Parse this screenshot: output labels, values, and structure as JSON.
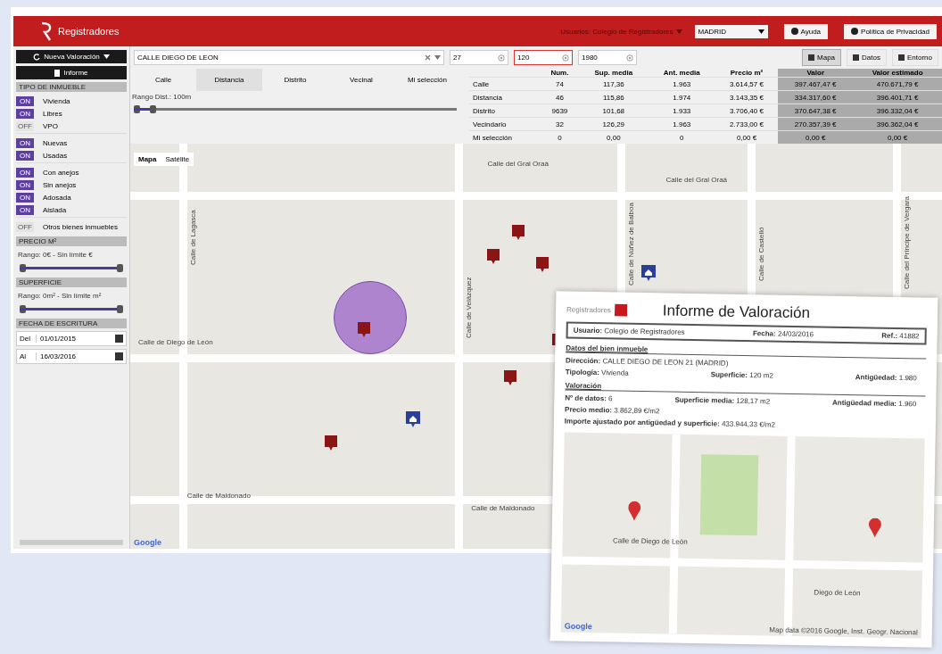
{
  "header": {
    "logo": "Registradores",
    "user": "Usuarios: Colegio de Registradores",
    "city": "MADRID",
    "buttons": [
      "Ayuda",
      "Política de Privacidad"
    ]
  },
  "sidebar": {
    "new_button": "Nueva Valoración",
    "report_button": "Informe",
    "type_heading": "TIPO DE INMUEBLE",
    "groups": [
      [
        {
          "label": "Vivienda",
          "on": true,
          "switch_text": "ON"
        },
        {
          "label": "Libres",
          "on": true,
          "switch_text": "ON"
        },
        {
          "label": "VPO",
          "on": false,
          "switch_text": "OFF"
        }
      ],
      [
        {
          "label": "Nuevas",
          "on": true,
          "switch_text": "ON"
        },
        {
          "label": "Usadas",
          "on": true,
          "switch_text": "ON"
        }
      ],
      [
        {
          "label": "Con anejos",
          "on": true,
          "switch_text": "ON"
        },
        {
          "label": "Sin anejos",
          "on": true,
          "switch_text": "ON"
        },
        {
          "label": "Adosada",
          "on": true,
          "switch_text": "ON"
        },
        {
          "label": "Aislada",
          "on": true,
          "switch_text": "ON"
        }
      ],
      [
        {
          "label": "Otros bienes inmuebles",
          "on": false,
          "switch_text": "OFF"
        }
      ]
    ],
    "ranges": [
      {
        "heading": "PRECIO M²",
        "label": "Rango: 0€ - Sin límite €",
        "level": 1
      },
      {
        "heading": "SUPERFICIE",
        "label": "Rango: 0m² - Sin límite m²",
        "level": 1
      }
    ],
    "date_heading": "FECHA DE ESCRITURA",
    "dates": [
      {
        "label": "Del",
        "value": "01/01/2015"
      },
      {
        "label": "Al",
        "value": "16/03/2016"
      }
    ]
  },
  "toolbar": {
    "address": "CALLE DIEGO DE LEON",
    "number": "27",
    "area": "120",
    "year": "1980",
    "views": [
      {
        "label": "Mapa",
        "selected": true
      },
      {
        "label": "Datos",
        "selected": false
      },
      {
        "label": "Entorno",
        "selected": false
      }
    ]
  },
  "tabs": [
    {
      "label": "Calle",
      "selected": false
    },
    {
      "label": "Distancia",
      "selected": true
    },
    {
      "label": "Distrito",
      "selected": false
    },
    {
      "label": "Vecinal",
      "selected": false
    },
    {
      "label": "Mi selección",
      "selected": false
    }
  ],
  "distance": {
    "label": "Rango Dist.: 100m",
    "level": 0.07
  },
  "table": {
    "columns": [
      "",
      "Num.",
      "Sup. media",
      "Ant. media",
      "Precio m²",
      "Valor",
      "Valor estimado"
    ],
    "rows": [
      [
        "Calle",
        "74",
        "117,36",
        "1.963",
        "3.614,57 €",
        "397.467,47 €",
        "470.671,79 €"
      ],
      [
        "Distancia",
        "46",
        "115,86",
        "1.974",
        "3.143,35 €",
        "334.317,60 €",
        "396.401,71 €"
      ],
      [
        "Distrito",
        "9639",
        "101,68",
        "1.933",
        "3.706,40 €",
        "370.647,38 €",
        "396.332,04 €"
      ],
      [
        "Vecindario",
        "32",
        "126,29",
        "1.963",
        "2.733,00 €",
        "270.357,39 €",
        "396.362,04 €"
      ],
      [
        "Mi selección",
        "0",
        "0,00",
        "0",
        "0,00 €",
        "0,00 €",
        "0,00 €"
      ]
    ]
  },
  "map": {
    "types": [
      {
        "label": "Mapa",
        "selected": true
      },
      {
        "label": "Satélite",
        "selected": false
      }
    ],
    "streets": [
      "Calle del Gral Oraá",
      "Calle del Gral Oraá",
      "Calle de Lagasca",
      "Calle de Velázquez",
      "Calle de Núñez de Balboa",
      "Calle de Castelló",
      "Calle del Príncipe de Vergara",
      "Calle de Maldonado",
      "Calle de Maldonado",
      "Calle de Diego de León"
    ],
    "google": "Google"
  },
  "report": {
    "logo": "Registradores",
    "title": "Informe de Valoración",
    "user": "**Usuario:** Colegio de Registradores",
    "date": "**Fecha:** 24/03/2016",
    "ref": "**Ref.:** 41882",
    "property_heading": "Datos del bien inmueble",
    "address": "**Dirección:** CALLE DIEGO DE LEON 21 (MADRID)",
    "type": "**Tipología:** Vivienda",
    "area": "**Superficie:** 120 m2",
    "age": "**Antigüedad:** 1.980",
    "valuation_heading": "Valoración",
    "count": "**Nº de datos:** 6",
    "mean_area": "**Superficie media:** 128,17 m2",
    "mean_age": "**Antigüedad media:** 1.960",
    "mean_price": "**Precio medio:** 3.862,89 €/m2",
    "adjusted": "**Importe ajustado por antigüedad y superficie:** 433.944,33 €/m2",
    "map_labels": [
      "Calle de Diego de León",
      "Diego de León"
    ],
    "map_credit": "Map data ©2016 Google, Inst. Geogr. Nacional",
    "google": "Google"
  }
}
